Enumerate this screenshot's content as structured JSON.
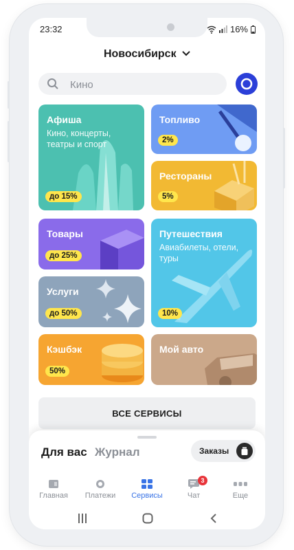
{
  "status_bar": {
    "time": "23:32",
    "battery": "16%"
  },
  "header": {
    "city": "Новосибирск"
  },
  "search": {
    "placeholder": "Кино"
  },
  "tiles": [
    {
      "title": "Афиша",
      "subtitle": "Кино, концерты, театры и спорт",
      "badge": "до 15%",
      "color": "#4cc0b0"
    },
    {
      "title": "Топливо",
      "subtitle": "",
      "badge": "2%",
      "color": "#6f9cf3"
    },
    {
      "title": "Рестораны",
      "subtitle": "",
      "badge": "5%",
      "color": "#f2b933"
    },
    {
      "title": "Товары",
      "subtitle": "",
      "badge": "до 25%",
      "color": "#8a6bea"
    },
    {
      "title": "Путешествия",
      "subtitle": "Авиабилеты, отели, туры",
      "badge": "10%",
      "color": "#52c6e8"
    },
    {
      "title": "Услуги",
      "subtitle": "",
      "badge": "до 50%",
      "color": "#8ea4bb"
    },
    {
      "title": "Кэшбэк",
      "subtitle": "",
      "badge": "50%",
      "color": "#f6a531"
    },
    {
      "title": "Мой авто",
      "subtitle": "",
      "badge": "",
      "color": "#cba88a"
    }
  ],
  "all_services": "ВСЕ СЕРВИСЫ",
  "feed": {
    "tab_for_you": "Для вас",
    "tab_journal": "Журнал",
    "orders": "Заказы"
  },
  "bottom_nav": [
    {
      "label": "Главная",
      "icon": "home-icon"
    },
    {
      "label": "Платежи",
      "icon": "payments-icon"
    },
    {
      "label": "Сервисы",
      "icon": "services-icon",
      "active": true
    },
    {
      "label": "Чат",
      "icon": "chat-icon",
      "badge": "3"
    },
    {
      "label": "Еще",
      "icon": "more-icon"
    }
  ]
}
